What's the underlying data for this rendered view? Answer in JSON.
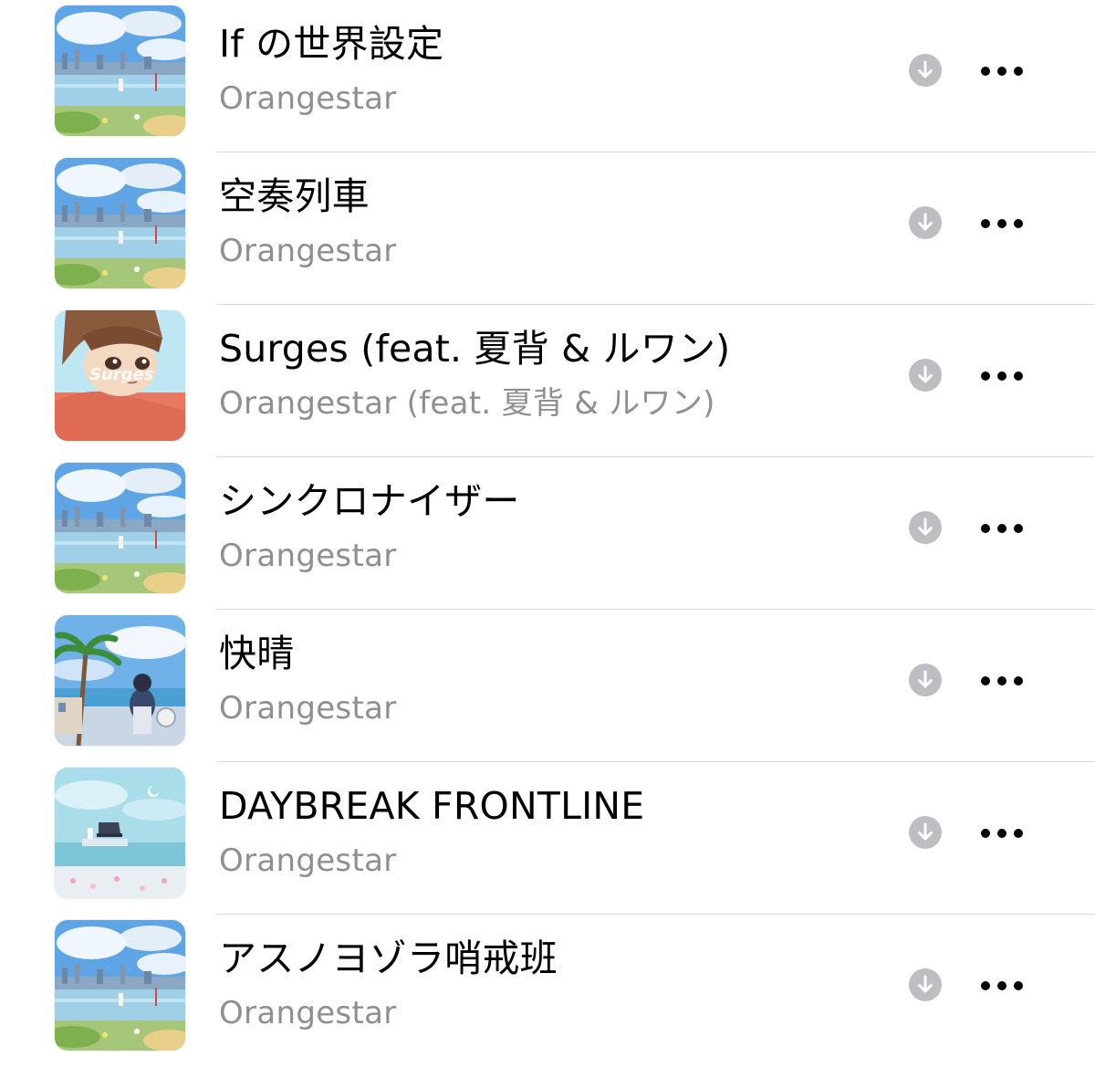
{
  "tracks": [
    {
      "title": "If の世界設定",
      "artist": "Orangestar",
      "artwork": "city-sky-album-art"
    },
    {
      "title": "空奏列車",
      "artist": "Orangestar",
      "artwork": "city-sky-album-art"
    },
    {
      "title": "Surges (feat. 夏背 & ルワン)",
      "artist": "Orangestar (feat. 夏背 & ルワン)",
      "artwork": "surges-portrait-art",
      "artwork_text": "Surges"
    },
    {
      "title": "シンクロナイザー",
      "artist": "Orangestar",
      "artwork": "city-sky-album-art"
    },
    {
      "title": "快晴",
      "artist": "Orangestar",
      "artwork": "seaside-palm-album-art"
    },
    {
      "title": "DAYBREAK FRONTLINE",
      "artist": "Orangestar",
      "artwork": "piano-sea-album-art"
    },
    {
      "title": "アスノヨゾラ哨戒班",
      "artist": "Orangestar",
      "artwork": "city-sky-album-art"
    }
  ],
  "icons": {
    "download": "download-circle-icon",
    "more": "ellipsis-more-icon"
  },
  "colors": {
    "title": "#000000",
    "artist": "#8e8e93",
    "download_icon": "#bdbdc2",
    "separator": "#d6d6da"
  }
}
